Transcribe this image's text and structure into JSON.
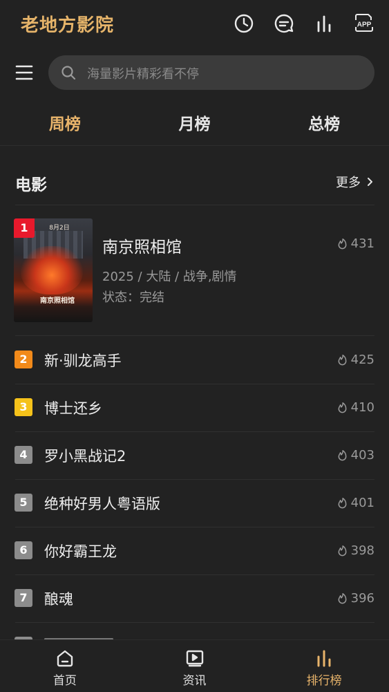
{
  "header": {
    "brand": "老地方影院",
    "icons": [
      "history-icon",
      "message-icon",
      "ranking-icon",
      "app-icon"
    ],
    "app_label": "APP"
  },
  "search": {
    "placeholder": "海量影片精彩看不停"
  },
  "tabs": [
    {
      "label": "周榜",
      "active": true
    },
    {
      "label": "月榜",
      "active": false
    },
    {
      "label": "总榜",
      "active": false
    }
  ],
  "section": {
    "title": "电影",
    "more": "更多"
  },
  "featured": {
    "rank": "1",
    "title": "南京照相馆",
    "meta": "2025 / 大陆 / 战争,剧情",
    "status": "状态：完结",
    "heat": "431",
    "poster": {
      "title_text": "南京照相馆",
      "date_text": "8月2日"
    }
  },
  "list": [
    {
      "rank": "2",
      "title": "新·驯龙高手",
      "heat": "425"
    },
    {
      "rank": "3",
      "title": "博士还乡",
      "heat": "410"
    },
    {
      "rank": "4",
      "title": "罗小黑战记2",
      "heat": "403"
    },
    {
      "rank": "5",
      "title": "绝种好男人粤语版",
      "heat": "401"
    },
    {
      "rank": "6",
      "title": "你好霸王龙",
      "heat": "398"
    },
    {
      "rank": "7",
      "title": "酿魂",
      "heat": "396"
    }
  ],
  "bottom_nav": [
    {
      "label": "首页",
      "icon": "home-icon",
      "active": false
    },
    {
      "label": "资讯",
      "icon": "news-icon",
      "active": false
    },
    {
      "label": "排行榜",
      "icon": "ranking-icon",
      "active": true
    }
  ],
  "colors": {
    "background": "#222222",
    "accent": "#e8b46b",
    "rank1": "#e8192c",
    "rank2": "#f28a1a",
    "rank3": "#f5c21a",
    "rank_other": "#8c8c8c"
  }
}
